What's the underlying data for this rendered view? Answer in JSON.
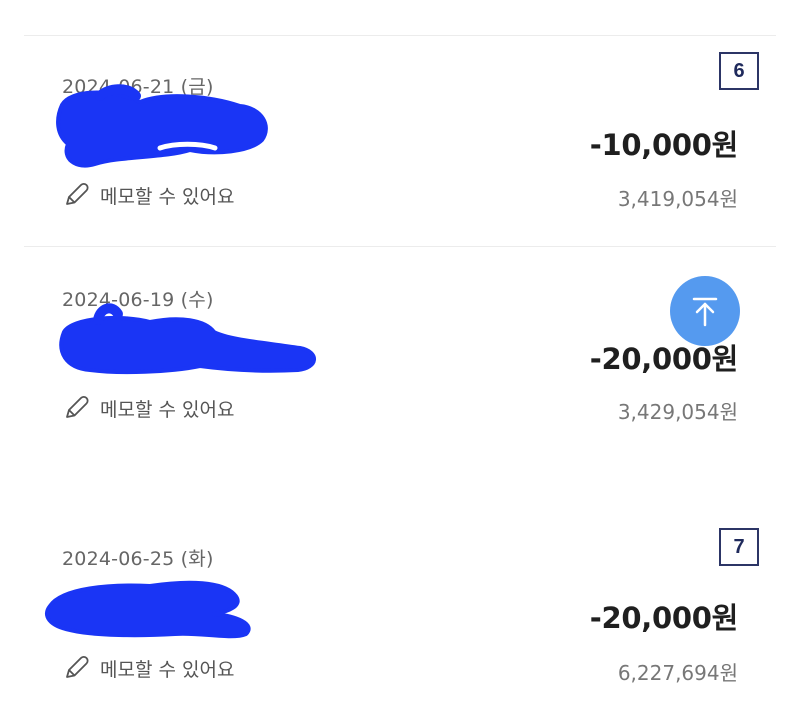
{
  "transactions": [
    {
      "date": "2024-06-21 (금)",
      "memo_label": "메모할 수 있어요",
      "amount": "-10,000원",
      "balance": "3,419,054원",
      "badge": "6"
    },
    {
      "date": "2024-06-19 (수)",
      "memo_label": "메모할 수 있어요",
      "amount": "-20,000원",
      "balance": "3,429,054원"
    },
    {
      "date": "2024-06-25 (화)",
      "memo_label": "메모할 수 있어요",
      "amount": "-20,000원",
      "balance": "6,227,694원",
      "badge": "7"
    }
  ],
  "icons": {
    "memo": "pencil-icon",
    "scroll_top": "arrow-up-to-top-icon",
    "redaction": "redaction-scribble"
  },
  "colors": {
    "redaction": "#1a35f5",
    "scroll_top_button": "#4c95ef",
    "badge_border": "#2c3566"
  }
}
